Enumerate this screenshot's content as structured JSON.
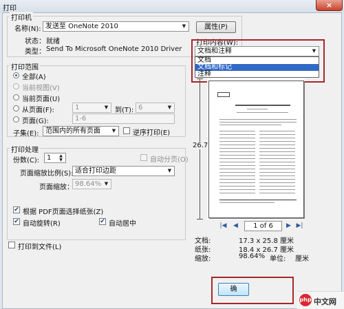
{
  "window": {
    "title": "打印",
    "close_icon": "×"
  },
  "printer": {
    "legend": "打印机",
    "name_label": "名称(N):",
    "name_value": "发送至 OneNote 2010",
    "properties_button": "属性(P)",
    "status_label": "状态：",
    "status_value": "就绪",
    "type_label": "类型：",
    "type_value": "Send To Microsoft OneNote 2010 Driver"
  },
  "print_content": {
    "label": "打印内容(W):",
    "selected": "文档和注释",
    "options": [
      "文档",
      "文档和标记",
      "注释"
    ],
    "highlighted_index": 1
  },
  "print_range": {
    "legend": "打印范围",
    "all": "全部(A)",
    "current_view": "当前视图(V)",
    "current_page": "当前页面(U)",
    "from_page": "从页面(F):",
    "from_value": "1",
    "to_label": "到(T):",
    "to_value": "6",
    "pages": "页面(G):",
    "pages_value": "1-6",
    "subset_label": "子集(E):",
    "subset_value": "范围内的所有页面",
    "reverse": "逆序打印(E)"
  },
  "print_handling": {
    "legend": "打印处理",
    "copies_label": "份数(C):",
    "copies_value": "1",
    "collate": "自动分页(O)",
    "scaling_label": "页面缩放比例(S):",
    "scaling_value": "适合打印边距",
    "zoom_label": "页面缩放：",
    "zoom_value": "98.64%",
    "choose_paper_by_pdf": "根据 PDF页面选择纸张(Z)",
    "auto_rotate": "自动旋转(R)",
    "auto_center": "自动居中"
  },
  "print_to_file": "打印到文件(L)",
  "preview": {
    "height_label": "26.7",
    "page_indicator": "1 of 6",
    "doc_label": "文档:",
    "doc_value": "17.3 x 25.8 厘米",
    "paper_label": "纸张:",
    "paper_value": "18.4 x 26.7 厘米",
    "scale_label": "缩放:",
    "scale_value": "98.64%",
    "unit_label": "单位:",
    "unit_value": "厘米"
  },
  "footer": {
    "ok_button_partial": "确"
  },
  "watermark": {
    "logo": "php",
    "text": "中文网"
  },
  "colors": {
    "highlight": "#a5262a",
    "selection": "#3169c6",
    "accent": "#2f5b9c"
  }
}
